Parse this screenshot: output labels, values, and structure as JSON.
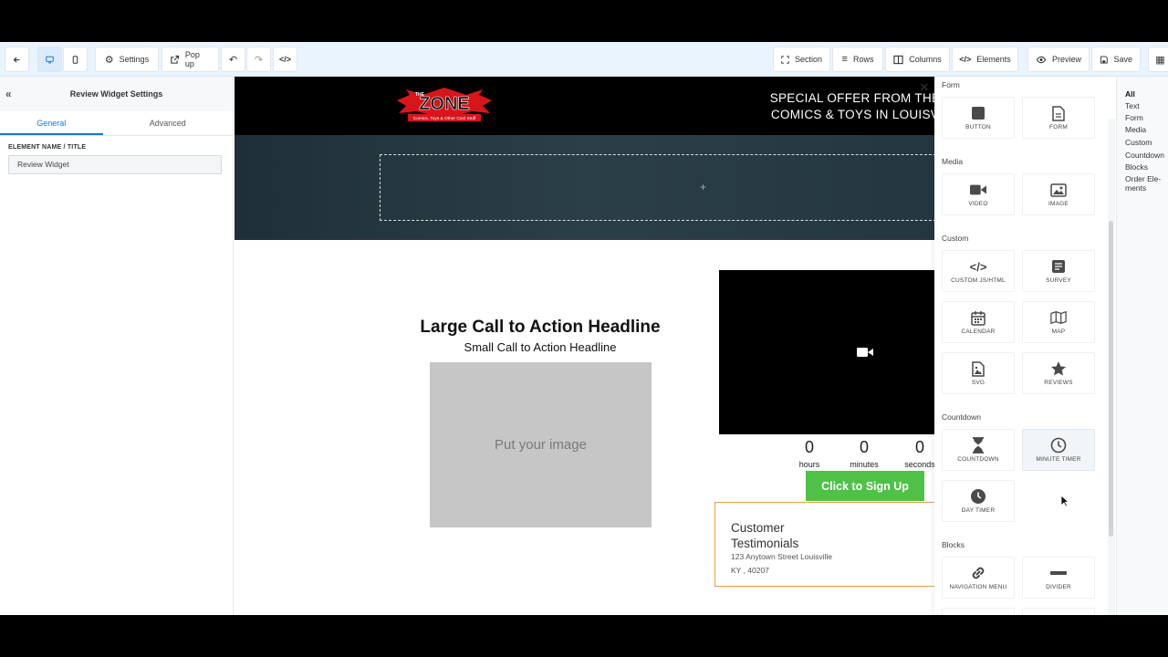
{
  "toolbar": {
    "back_icon": "arrow-left-icon",
    "desktop_icon": "desktop-icon",
    "mobile_icon": "mobile-icon",
    "settings_label": "Settings",
    "popup_label": "Pop up",
    "section_label": "Section",
    "rows_label": "Rows",
    "columns_label": "Columns",
    "elements_label": "Elements",
    "preview_label": "Preview",
    "save_label": "Save"
  },
  "left_panel": {
    "title": "Review Widget Settings",
    "tabs": [
      "General",
      "Advanced"
    ],
    "field_label": "ELEMENT NAME / TITLE",
    "field_value": "Review Widget"
  },
  "canvas": {
    "logo_text": "ZONE",
    "logo_top": "THE",
    "logo_tagline": "Comics, Toys & Other Cool Stuff",
    "offer_line1": "SPECIAL OFFER FROM THE",
    "offer_line2": "COMICS & TOYS IN LOUISV",
    "drop_plus": "+",
    "headline_large": "Large Call to Action Headline",
    "headline_small": "Small Call to Action Headline",
    "image_placeholder": "Put your image",
    "countdown": {
      "hours_value": "0",
      "minutes_value": "0",
      "seconds_value": "0",
      "hours_label": "hours",
      "minutes_label": "minutes",
      "seconds_label": "seconds"
    },
    "signup_label": "Click to Sign Up",
    "testimonial": {
      "title": "Customer Testimonials",
      "address": "123 Anytown Street Louisville",
      "city": "KY , 40207"
    }
  },
  "elements_panel": {
    "sections": {
      "form": "Form",
      "media": "Media",
      "custom": "Custom",
      "countdown": "Countdown",
      "blocks": "Blocks"
    },
    "tiles": {
      "button": "BUTTON",
      "form": "FORM",
      "video": "VIDEO",
      "image": "IMAGE",
      "custom_js": "CUSTOM JS/HTML",
      "survey": "SURVEY",
      "calendar": "CALENDAR",
      "map": "MAP",
      "svg": "SVG",
      "reviews": "REVIEWS",
      "countdown": "COUNTDOWN",
      "minute_timer": "MINUTE TIMER",
      "day_timer": "DAY TIMER",
      "navigation_menu": "NAVIGATION MENU",
      "divider": "DIVIDER"
    }
  },
  "categories": [
    "All",
    "Text",
    "Form",
    "Media",
    "Custom",
    "Countdown",
    "Blocks",
    "Order Ele-ments"
  ],
  "colors": {
    "accent": "#1976d2",
    "signup_green": "#4dc247",
    "testimonial_border": "#e2a444",
    "toolbar_bg": "#eaf4fe"
  }
}
